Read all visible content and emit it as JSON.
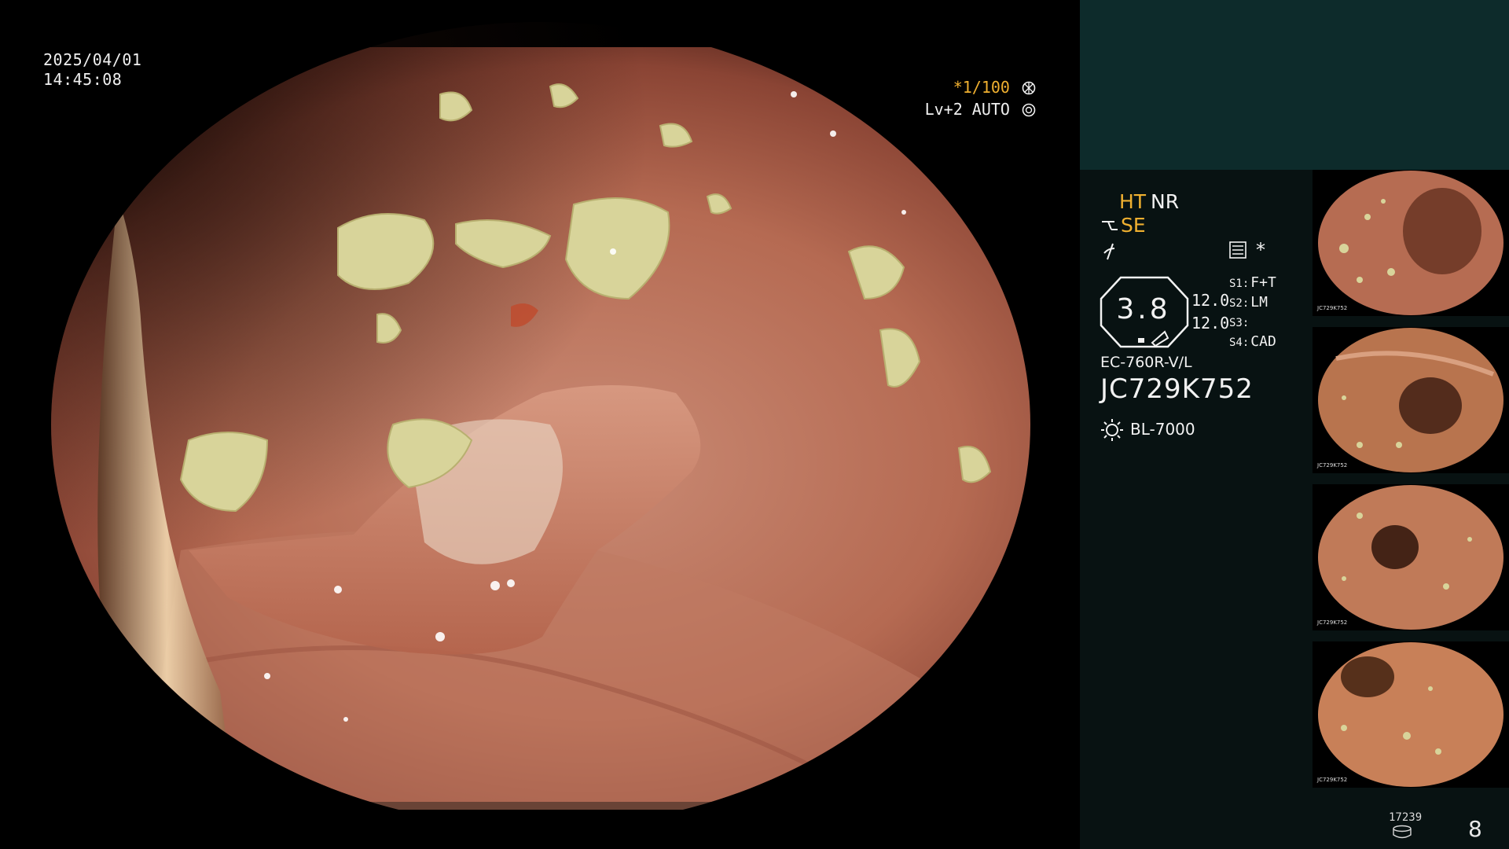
{
  "overlay": {
    "date": "2025/04/01",
    "time": "14:45:08",
    "shutter": "*1/100",
    "level": "Lv+2 AUTO"
  },
  "panel": {
    "ht": "HT",
    "nr": "NR",
    "se": "SE",
    "star": "*",
    "gauge_value": "3.8",
    "setting_value_1": "12.0",
    "setting_value_2": "12.0",
    "slots": [
      {
        "key": "S1:",
        "value": "F+T"
      },
      {
        "key": "S2:",
        "value": "LM"
      },
      {
        "key": "S3:",
        "value": ""
      },
      {
        "key": "S4:",
        "value": "CAD"
      }
    ],
    "scope_model": "EC-760R-V/L",
    "serial_number": "JC729K752",
    "light_source": "BL-7000",
    "thumbnail_caption": "JC729K752",
    "counter": "17239",
    "capture_count": "8"
  },
  "colors": {
    "accent_orange": "#f0b030",
    "panel_background": "#081212",
    "panel_header": "#0d2b2b",
    "text": "#f2f2f2"
  },
  "icons": [
    "shutter-mode-icon",
    "auto-iris-icon",
    "structure-enhancement-icon",
    "color-enhancement-icon",
    "menu-icon",
    "light-source-icon",
    "storage-icon"
  ]
}
